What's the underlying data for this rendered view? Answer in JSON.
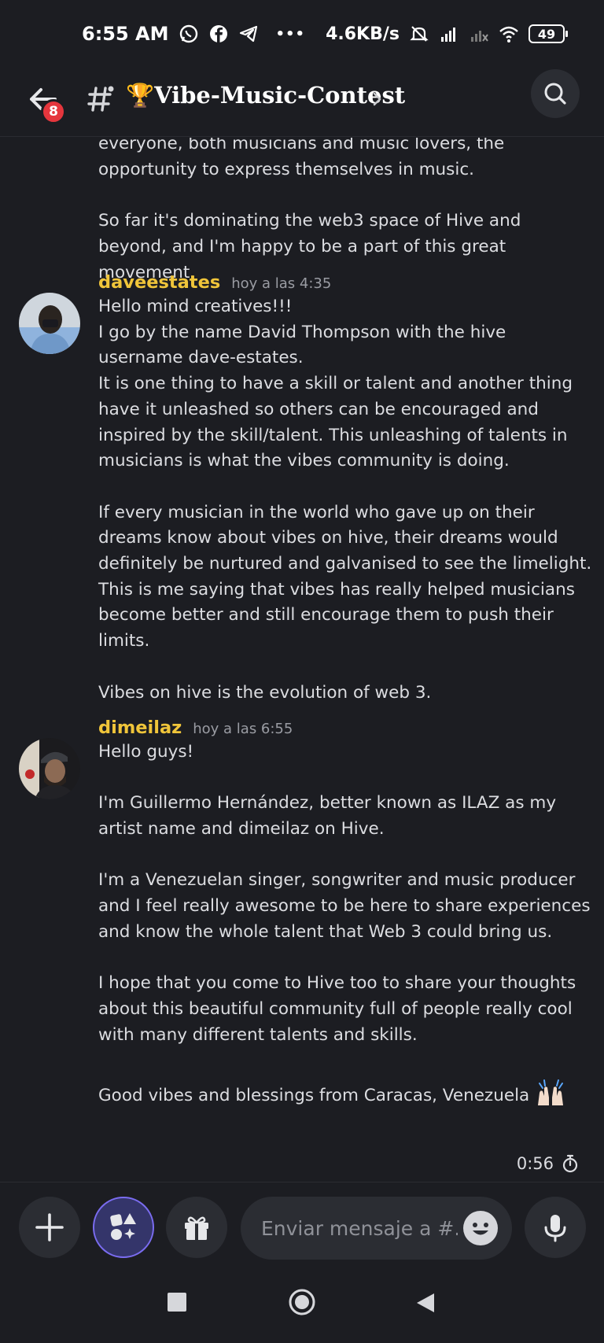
{
  "status_bar": {
    "time": "6:55 AM",
    "network_speed": "4.6KB/s",
    "battery": "49",
    "more": "•••"
  },
  "header": {
    "badge_count": "8",
    "channel_name": "🏆Vibe-Music-Contest"
  },
  "messages": [
    {
      "continuation": true,
      "paragraphs": [
        "everyone, both musicians and music lovers, the opportunity to express themselves in music.",
        "So far it's dominating the web3 space of Hive and beyond, and I'm happy to be a part of this great movement."
      ]
    },
    {
      "author": "daveestates",
      "time": "hoy a las 4:35",
      "paragraphs": [
        "Hello mind creatives!!!\nI go by the name David Thompson with the hive username dave-estates.\nIt is one thing to have a skill or talent and another thing have it unleashed so others can be encouraged and inspired by the skill/talent. This unleashing of talents in musicians is what the vibes community is doing.",
        "If every musician in the world who gave up on their dreams know about vibes on hive, their dreams would definitely be nurtured and galvanised to see the limelight. This is me saying that vibes has really helped musicians become better and still encourage them to push their limits.",
        "Vibes on hive is the evolution of web 3."
      ]
    },
    {
      "author": "dimeilaz",
      "time": "hoy a las 6:55",
      "paragraphs": [
        "Hello guys!",
        "I'm Guillermo Hernández, better known as ILAZ as my artist name and dimeilaz on Hive.",
        "I'm a Venezuelan singer, songwriter and music producer and I feel really awesome to be here to share experiences and know the whole talent that Web 3 could bring us.",
        "I hope that you come to Hive too to share your thoughts about this beautiful community full of people really cool with many different talents and skills.",
        "Good vibes and blessings from Caracas, Venezuela"
      ]
    }
  ],
  "slowmode_timer": "0:56",
  "composer": {
    "placeholder": "Enviar mensaje a #..."
  },
  "colors": {
    "background": "#1c1d22",
    "author_name": "#f0c53a",
    "badge": "#e5363d",
    "apps_accent": "#7a6cf0"
  }
}
